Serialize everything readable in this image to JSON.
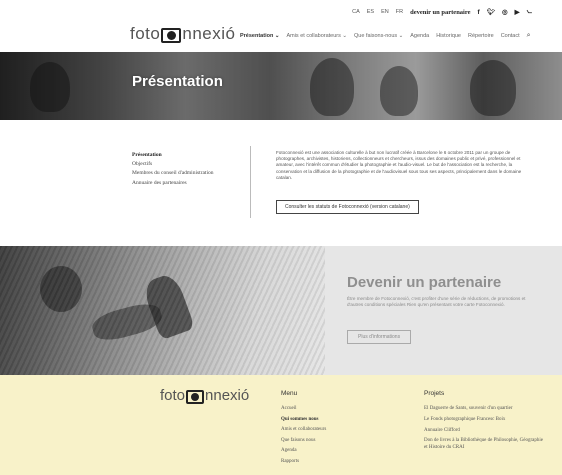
{
  "topbar": {
    "langs": [
      "CA",
      "ES",
      "EN",
      "FR"
    ],
    "partner_link": "devenir un partenaire",
    "social_icons": [
      "facebook-icon",
      "twitter-icon",
      "instagram-icon",
      "youtube-icon",
      "rss-icon"
    ]
  },
  "logo": {
    "before": "foto",
    "after": "nnexió"
  },
  "nav": {
    "items": [
      "Présentation ⌄",
      "Amis et collaborateurs ⌄",
      "Que faisons-nous ⌄",
      "Agenda",
      "Historique",
      "Répertoire",
      "Contact"
    ]
  },
  "hero": {
    "title": "Présentation"
  },
  "presentation": {
    "sidebar": [
      "Présentation",
      "Objectifs",
      "Membres du conseil d'administration",
      "Annuaire des partenaires"
    ],
    "text": "Fotoconnexió est une association culturelle à but non lucratif créée à Barcelone le 6 octobre 2011 par un groupe de photographes, archivistes, historiens, collectionneurs et chercheurs, issus des domaines public et privé, professionnel et amateur, avec l'intérêt commun d'étudier la photographie et l'audio-visuel. Le but de l'association est la recherche, la conservation et la diffusion de la photographie et de l'audiovisuel sous tous ses aspects, principalement dans le domaine catalan.",
    "button": "Consulter les statuts de Fotoconnexió (version catalane)"
  },
  "partner": {
    "title": "Devenir un partenaire",
    "text": "Être membre de Fotoconnexió, c'est profiter d'une série de réductions, de promotions et d'autres conditions spéciales Rien qu'en présentant votre carte Fotoconnexió.",
    "button": "Plus d'informations"
  },
  "footer": {
    "menu_title": "Menu",
    "menu_items": [
      "Accueil",
      "Qui sommes nous",
      "Amis et collaborateurs",
      "Que faisons nous",
      "Agenda",
      "Rapports"
    ],
    "projects_title": "Projets",
    "projects": [
      "El Daguerre de Sants, souvenir d'un quartier",
      "Le Fonds photographique Francesc Boix",
      "Annuaire Clifford",
      "Don de livres à la Bibliothèque de Philosophie, Géographie et Histoire du CRAI"
    ]
  },
  "colors": {
    "footer_bg": "#f8f2c9",
    "banner_bg": "#e6e6e6"
  }
}
